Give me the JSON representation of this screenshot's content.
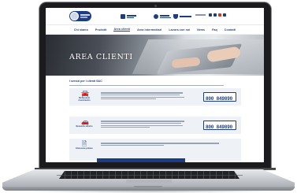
{
  "hero": {
    "title": "AREA CLIENTI"
  },
  "nav": {
    "items": [
      "Chi siamo",
      "Prodotti",
      "Area clienti",
      "Area intermediari",
      "Lavora con noi",
      "News",
      "Faq",
      "Contatti"
    ]
  },
  "content": {
    "section_title": "I servizi per i clienti S&C"
  },
  "cards": [
    {
      "label": "Richiesta di risarcimento",
      "icon": "car-icon",
      "phone": "800 849890"
    },
    {
      "label": "Denuncia sinistro",
      "icon": "car-crash-icon",
      "phone": "800 849890"
    },
    {
      "label": "Emissione polizze",
      "icon": "document-icon",
      "phone": ""
    }
  ],
  "colors": {
    "brand": "#1c3d84",
    "card_bg": "#eef1f6"
  }
}
